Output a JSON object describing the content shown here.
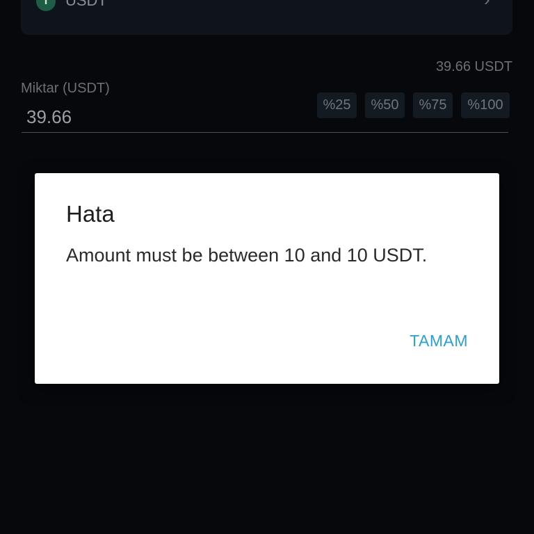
{
  "asset": {
    "icon": "tether-icon",
    "icon_glyph": "T",
    "name": "USDT",
    "chevron": "›"
  },
  "amount": {
    "balance": "39.66 USDT",
    "label": "Miktar (USDT)",
    "value": "39.66",
    "percent_buttons": [
      "%25",
      "%50",
      "%75",
      "%100"
    ]
  },
  "colors": {
    "background": "#06080b",
    "dialog_background": "#ffffff",
    "accent": "#2b9fd4"
  },
  "dialog": {
    "title": "Hata",
    "message": "Amount must be between 10 and 10 USDT.",
    "ok_label": "TAMAM"
  }
}
